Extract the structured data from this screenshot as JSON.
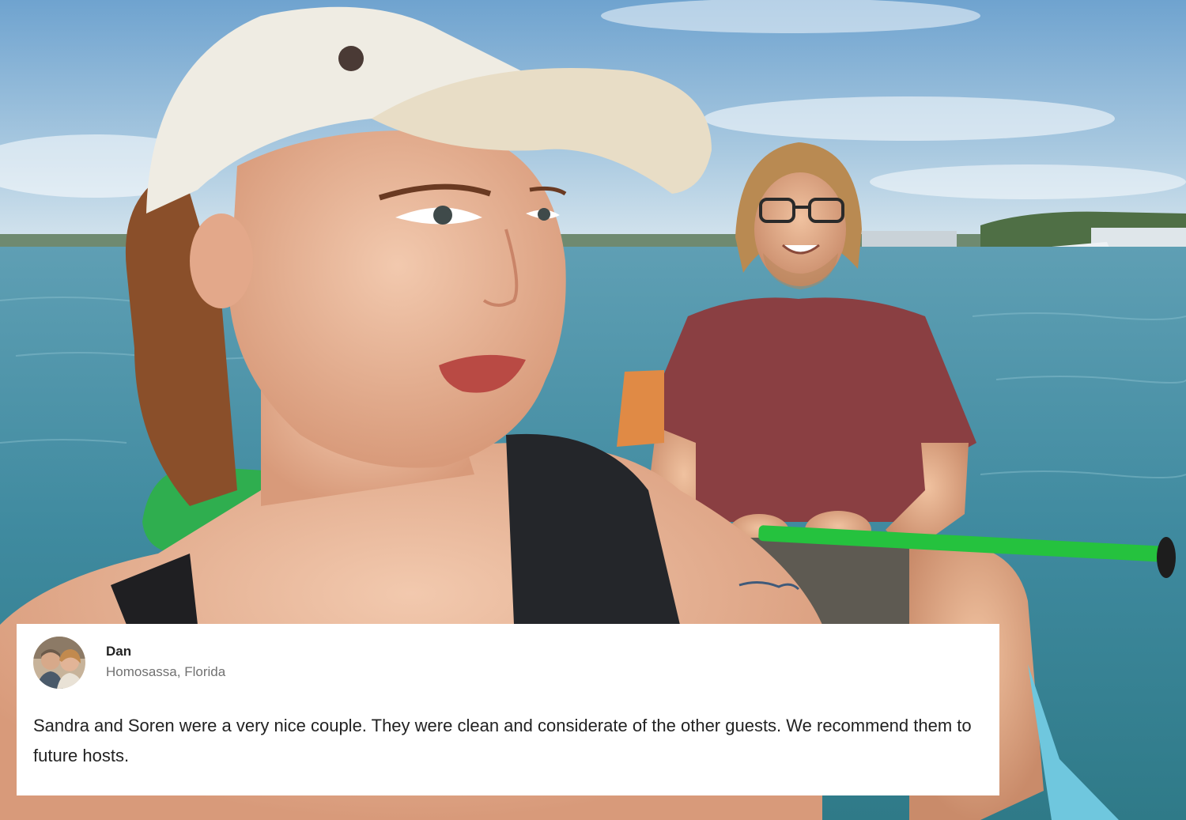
{
  "review": {
    "reviewer_name": "Dan",
    "reviewer_location": "Homosassa, Florida",
    "text": "Sandra and Soren were a very nice couple. They were clean and considerate of the other guests. We recommend them to future hosts."
  },
  "colors": {
    "card_background": "#ffffff",
    "name_text": "#222222",
    "location_text": "#717171",
    "body_text": "#222222"
  }
}
